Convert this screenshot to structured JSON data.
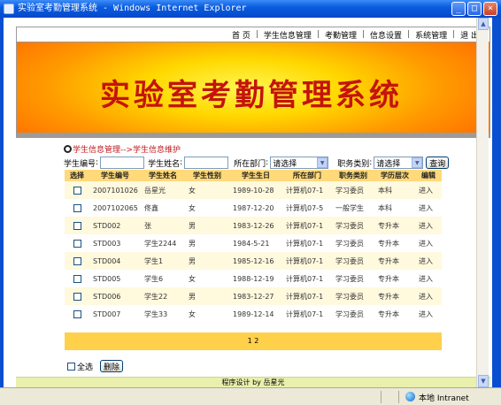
{
  "window": {
    "title": "实验室考勤管理系统 - Windows Internet Explorer",
    "min": "_",
    "max": "□",
    "close": "×"
  },
  "nav": {
    "items": [
      "首 页",
      "学生信息管理",
      "考勤管理",
      "信息设置",
      "系统管理",
      "退 出"
    ],
    "separator": "|"
  },
  "banner": {
    "title": "实验室考勤管理系统"
  },
  "breadcrumb": "学生信息管理-->学生信息维护",
  "search": {
    "student_no_label": "学生编号",
    "student_name_label": "学生姓名",
    "department_label": "所在部门",
    "department_value": "请选择",
    "position_label": "职务类别",
    "position_value": "请选择",
    "query_button": "查询"
  },
  "table": {
    "headers": [
      "选择",
      "学生编号",
      "学生姓名",
      "学生性别",
      "学生生日",
      "所在部门",
      "职务类别",
      "学历层次",
      "编辑"
    ],
    "rows": [
      [
        "2007101026",
        "岳星光",
        "女",
        "1989-10-28",
        "计算机07-1",
        "学习委员",
        "本科",
        "进入"
      ],
      [
        "2007102065",
        "佟鑫",
        "女",
        "1987-12-20",
        "计算机07-5",
        "一般学生",
        "本科",
        "进入"
      ],
      [
        "STD002",
        "张",
        "男",
        "1983-12-26",
        "计算机07-1",
        "学习委员",
        "专升本",
        "进入"
      ],
      [
        "STD003",
        "学生2244",
        "男",
        "1984-5-21",
        "计算机07-1",
        "学习委员",
        "专升本",
        "进入"
      ],
      [
        "STD004",
        "学生1",
        "男",
        "1985-12-16",
        "计算机07-1",
        "学习委员",
        "专升本",
        "进入"
      ],
      [
        "STD005",
        "学生6",
        "女",
        "1988-12-19",
        "计算机07-1",
        "学习委员",
        "专升本",
        "进入"
      ],
      [
        "STD006",
        "学生22",
        "男",
        "1983-12-27",
        "计算机07-1",
        "学习委员",
        "专升本",
        "进入"
      ],
      [
        "STD007",
        "学生33",
        "女",
        "1989-12-14",
        "计算机07-1",
        "学习委员",
        "专升本",
        "进入"
      ]
    ]
  },
  "pager": "1 2",
  "bottom": {
    "select_all": "全选",
    "delete_button": "删除"
  },
  "footer": "程序设计 by 岳星光",
  "status": {
    "zone": "本地 Intranet"
  }
}
